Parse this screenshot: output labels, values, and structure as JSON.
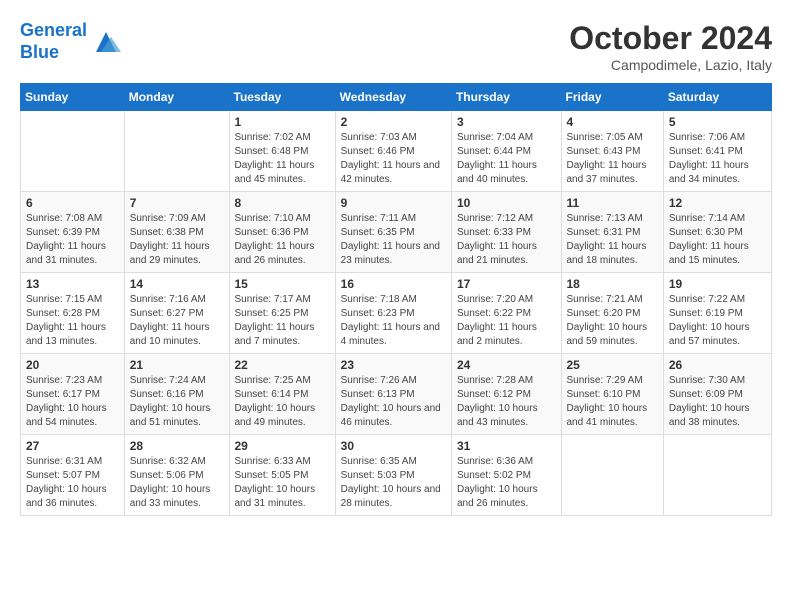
{
  "header": {
    "logo_line1": "General",
    "logo_line2": "Blue",
    "month_title": "October 2024",
    "location": "Campodimele, Lazio, Italy"
  },
  "weekdays": [
    "Sunday",
    "Monday",
    "Tuesday",
    "Wednesday",
    "Thursday",
    "Friday",
    "Saturday"
  ],
  "weeks": [
    [
      {
        "day": "",
        "info": ""
      },
      {
        "day": "",
        "info": ""
      },
      {
        "day": "1",
        "info": "Sunrise: 7:02 AM\nSunset: 6:48 PM\nDaylight: 11 hours and 45 minutes."
      },
      {
        "day": "2",
        "info": "Sunrise: 7:03 AM\nSunset: 6:46 PM\nDaylight: 11 hours and 42 minutes."
      },
      {
        "day": "3",
        "info": "Sunrise: 7:04 AM\nSunset: 6:44 PM\nDaylight: 11 hours and 40 minutes."
      },
      {
        "day": "4",
        "info": "Sunrise: 7:05 AM\nSunset: 6:43 PM\nDaylight: 11 hours and 37 minutes."
      },
      {
        "day": "5",
        "info": "Sunrise: 7:06 AM\nSunset: 6:41 PM\nDaylight: 11 hours and 34 minutes."
      }
    ],
    [
      {
        "day": "6",
        "info": "Sunrise: 7:08 AM\nSunset: 6:39 PM\nDaylight: 11 hours and 31 minutes."
      },
      {
        "day": "7",
        "info": "Sunrise: 7:09 AM\nSunset: 6:38 PM\nDaylight: 11 hours and 29 minutes."
      },
      {
        "day": "8",
        "info": "Sunrise: 7:10 AM\nSunset: 6:36 PM\nDaylight: 11 hours and 26 minutes."
      },
      {
        "day": "9",
        "info": "Sunrise: 7:11 AM\nSunset: 6:35 PM\nDaylight: 11 hours and 23 minutes."
      },
      {
        "day": "10",
        "info": "Sunrise: 7:12 AM\nSunset: 6:33 PM\nDaylight: 11 hours and 21 minutes."
      },
      {
        "day": "11",
        "info": "Sunrise: 7:13 AM\nSunset: 6:31 PM\nDaylight: 11 hours and 18 minutes."
      },
      {
        "day": "12",
        "info": "Sunrise: 7:14 AM\nSunset: 6:30 PM\nDaylight: 11 hours and 15 minutes."
      }
    ],
    [
      {
        "day": "13",
        "info": "Sunrise: 7:15 AM\nSunset: 6:28 PM\nDaylight: 11 hours and 13 minutes."
      },
      {
        "day": "14",
        "info": "Sunrise: 7:16 AM\nSunset: 6:27 PM\nDaylight: 11 hours and 10 minutes."
      },
      {
        "day": "15",
        "info": "Sunrise: 7:17 AM\nSunset: 6:25 PM\nDaylight: 11 hours and 7 minutes."
      },
      {
        "day": "16",
        "info": "Sunrise: 7:18 AM\nSunset: 6:23 PM\nDaylight: 11 hours and 4 minutes."
      },
      {
        "day": "17",
        "info": "Sunrise: 7:20 AM\nSunset: 6:22 PM\nDaylight: 11 hours and 2 minutes."
      },
      {
        "day": "18",
        "info": "Sunrise: 7:21 AM\nSunset: 6:20 PM\nDaylight: 10 hours and 59 minutes."
      },
      {
        "day": "19",
        "info": "Sunrise: 7:22 AM\nSunset: 6:19 PM\nDaylight: 10 hours and 57 minutes."
      }
    ],
    [
      {
        "day": "20",
        "info": "Sunrise: 7:23 AM\nSunset: 6:17 PM\nDaylight: 10 hours and 54 minutes."
      },
      {
        "day": "21",
        "info": "Sunrise: 7:24 AM\nSunset: 6:16 PM\nDaylight: 10 hours and 51 minutes."
      },
      {
        "day": "22",
        "info": "Sunrise: 7:25 AM\nSunset: 6:14 PM\nDaylight: 10 hours and 49 minutes."
      },
      {
        "day": "23",
        "info": "Sunrise: 7:26 AM\nSunset: 6:13 PM\nDaylight: 10 hours and 46 minutes."
      },
      {
        "day": "24",
        "info": "Sunrise: 7:28 AM\nSunset: 6:12 PM\nDaylight: 10 hours and 43 minutes."
      },
      {
        "day": "25",
        "info": "Sunrise: 7:29 AM\nSunset: 6:10 PM\nDaylight: 10 hours and 41 minutes."
      },
      {
        "day": "26",
        "info": "Sunrise: 7:30 AM\nSunset: 6:09 PM\nDaylight: 10 hours and 38 minutes."
      }
    ],
    [
      {
        "day": "27",
        "info": "Sunrise: 6:31 AM\nSunset: 5:07 PM\nDaylight: 10 hours and 36 minutes."
      },
      {
        "day": "28",
        "info": "Sunrise: 6:32 AM\nSunset: 5:06 PM\nDaylight: 10 hours and 33 minutes."
      },
      {
        "day": "29",
        "info": "Sunrise: 6:33 AM\nSunset: 5:05 PM\nDaylight: 10 hours and 31 minutes."
      },
      {
        "day": "30",
        "info": "Sunrise: 6:35 AM\nSunset: 5:03 PM\nDaylight: 10 hours and 28 minutes."
      },
      {
        "day": "31",
        "info": "Sunrise: 6:36 AM\nSunset: 5:02 PM\nDaylight: 10 hours and 26 minutes."
      },
      {
        "day": "",
        "info": ""
      },
      {
        "day": "",
        "info": ""
      }
    ]
  ]
}
